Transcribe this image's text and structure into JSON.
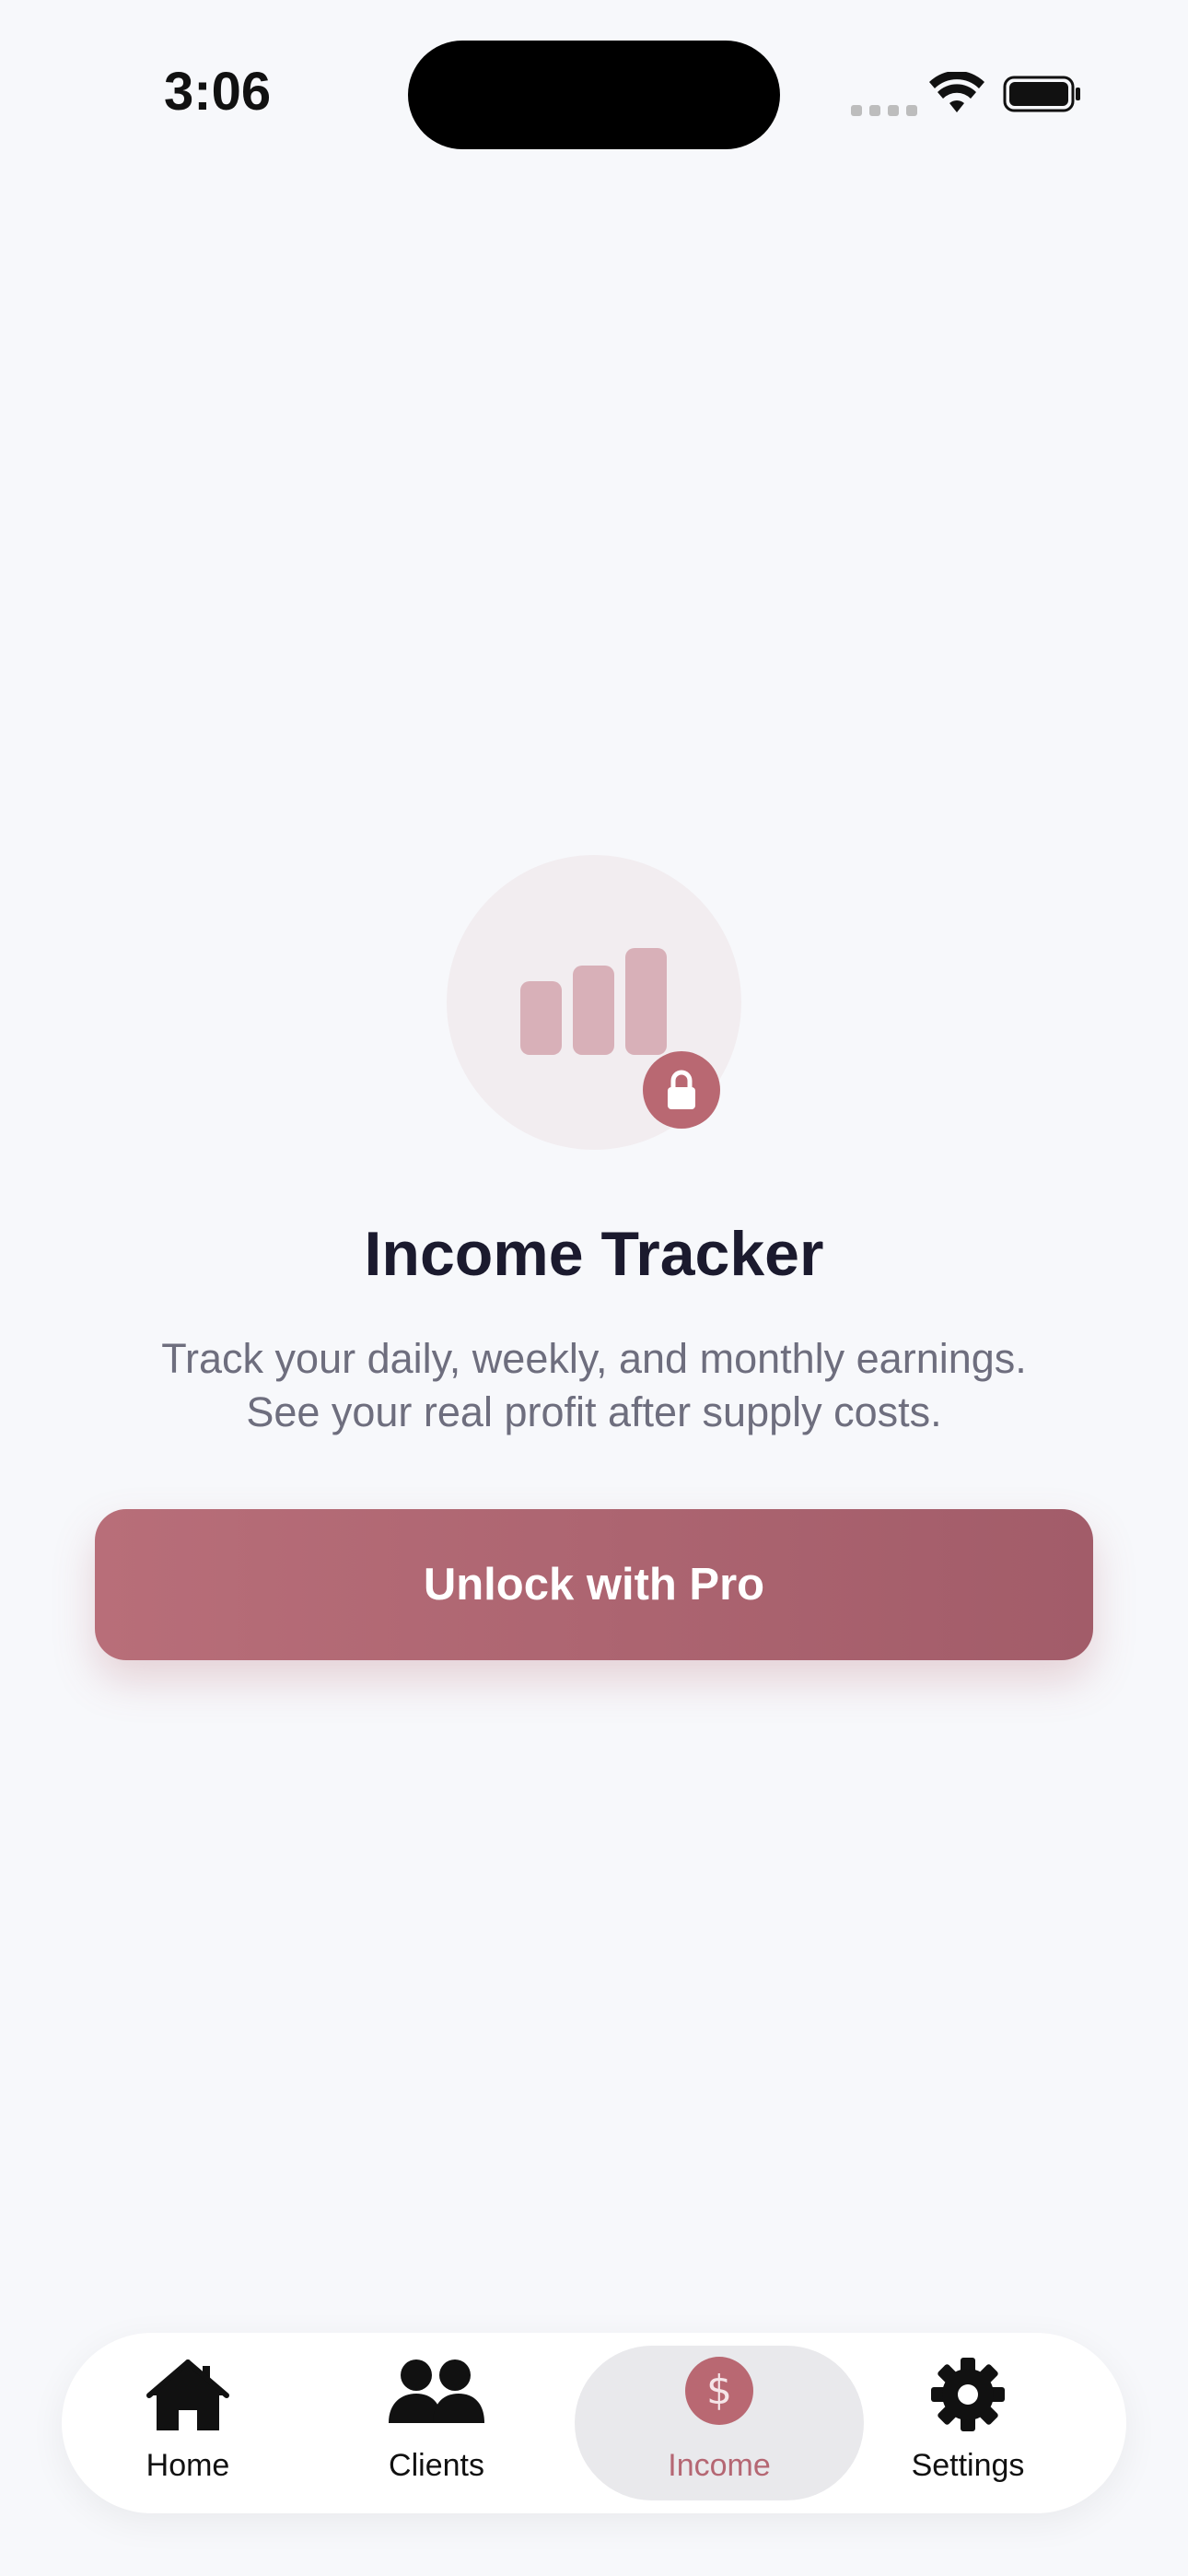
{
  "status_bar": {
    "time": "3:06"
  },
  "locked_feature": {
    "title": "Income Tracker",
    "description_line1": "Track your daily, weekly, and monthly earnings.",
    "description_line2": "See your real profit after supply costs.",
    "unlock_button_label": "Unlock with Pro",
    "hero_icon": "bar-chart-icon",
    "badge_icon": "lock-icon"
  },
  "tab_bar": {
    "tabs": [
      {
        "label": "Home",
        "icon": "house-icon",
        "active": false
      },
      {
        "label": "Clients",
        "icon": "people-icon",
        "active": false
      },
      {
        "label": "Income",
        "icon": "dollar-icon",
        "active": true
      },
      {
        "label": "Settings",
        "icon": "gear-icon",
        "active": false
      }
    ]
  },
  "colors": {
    "background": "#F7F8FB",
    "accent": "#B96872",
    "accent_light": "#D8B0B8",
    "title": "#1B1A2E",
    "body_text": "#6E6E7E"
  }
}
